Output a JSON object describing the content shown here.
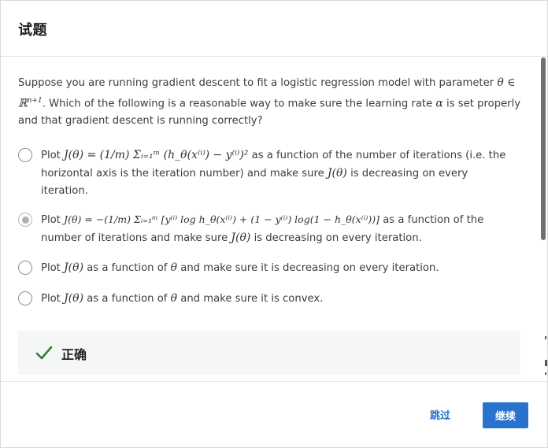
{
  "header": {
    "title": "试题"
  },
  "question": {
    "text_1": "Suppose you are running gradient descent to fit a logistic regression model with parameter ",
    "math_1": "θ ∈ ℝ",
    "math_1_sup": "n+1",
    "text_2": ". Which of the following is a reasonable way to make sure the learning rate ",
    "math_2": "α",
    "text_3": " is set properly and that gradient descent is running correctly?"
  },
  "options": [
    {
      "pre": "Plot ",
      "math": "J(θ) = (1/m) Σᵢ₌₁ᵐ (h_θ(x⁽ⁱ⁾) − y⁽ⁱ⁾)²",
      "post": " as a function of the number of iterations (i.e. the horizontal axis is the iteration number) and make sure ",
      "math_b": "J(θ)",
      "post_b": " is decreasing on every iteration.",
      "selected": false
    },
    {
      "pre": "Plot ",
      "math": "J(θ) = −(1/m) Σᵢ₌₁ᵐ [y⁽ⁱ⁾ log h_θ(x⁽ⁱ⁾) + (1 − y⁽ⁱ⁾) log(1 − h_θ(x⁽ⁱ⁾))]",
      "post": " as a function of the number of iterations and make sure ",
      "math_b": "J(θ)",
      "post_b": " is decreasing on every iteration.",
      "selected": true
    },
    {
      "pre": "Plot ",
      "math": "J(θ)",
      "post": " as a function of ",
      "math_b": "θ",
      "post_b": " and make sure it is decreasing on every iteration.",
      "selected": false
    },
    {
      "pre": "Plot ",
      "math": "J(θ)",
      "post": " as a function of ",
      "math_b": "θ",
      "post_b": " and make sure it is convex.",
      "selected": false
    }
  ],
  "result": {
    "label": "正确",
    "icon": "check-icon",
    "color": "#2e7d32"
  },
  "footer": {
    "skip_label": "跳过",
    "continue_label": "继续"
  },
  "colors": {
    "accent": "#2a73cc"
  }
}
